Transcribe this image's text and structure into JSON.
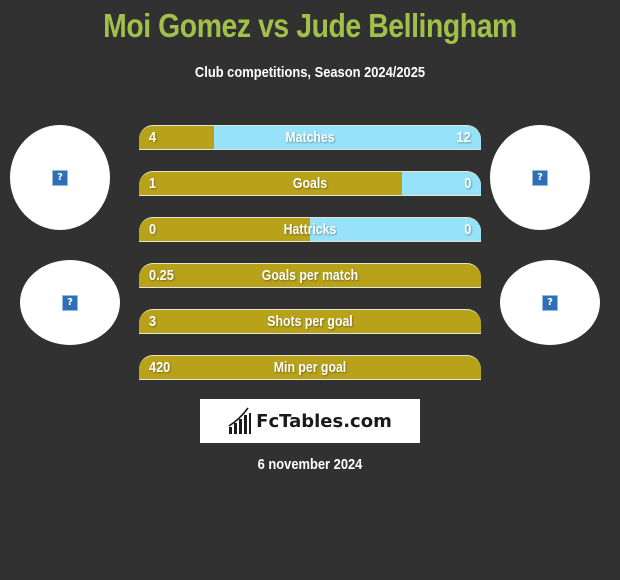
{
  "header": {
    "title": "Moi Gomez vs Jude Bellingham",
    "subtitle": "Club competitions, Season 2024/2025"
  },
  "players": {
    "left": {
      "name": "Moi Gomez",
      "photo_icon": "broken-image-icon",
      "club_icon": "broken-image-icon"
    },
    "right": {
      "name": "Jude Bellingham",
      "photo_icon": "broken-image-icon",
      "club_icon": "broken-image-icon"
    }
  },
  "colors": {
    "left_bar": "#b8a21a",
    "right_bar": "#96e2f8",
    "title": "#a0c04a",
    "background": "#313131"
  },
  "stats": [
    {
      "label": "Matches",
      "left": "4",
      "right": "12",
      "left_fraction": 0.22
    },
    {
      "label": "Goals",
      "left": "1",
      "right": "0",
      "left_fraction": 0.77
    },
    {
      "label": "Hattricks",
      "left": "0",
      "right": "0",
      "left_fraction": 0.5
    },
    {
      "label": "Goals per match",
      "left": "0.25",
      "right": "",
      "left_fraction": 1.0
    },
    {
      "label": "Shots per goal",
      "left": "3",
      "right": "",
      "left_fraction": 1.0
    },
    {
      "label": "Min per goal",
      "left": "420",
      "right": "",
      "left_fraction": 1.0
    }
  ],
  "logo": {
    "text": "FcTables.com",
    "icon": "bar-chart-icon"
  },
  "date": "6 november 2024"
}
